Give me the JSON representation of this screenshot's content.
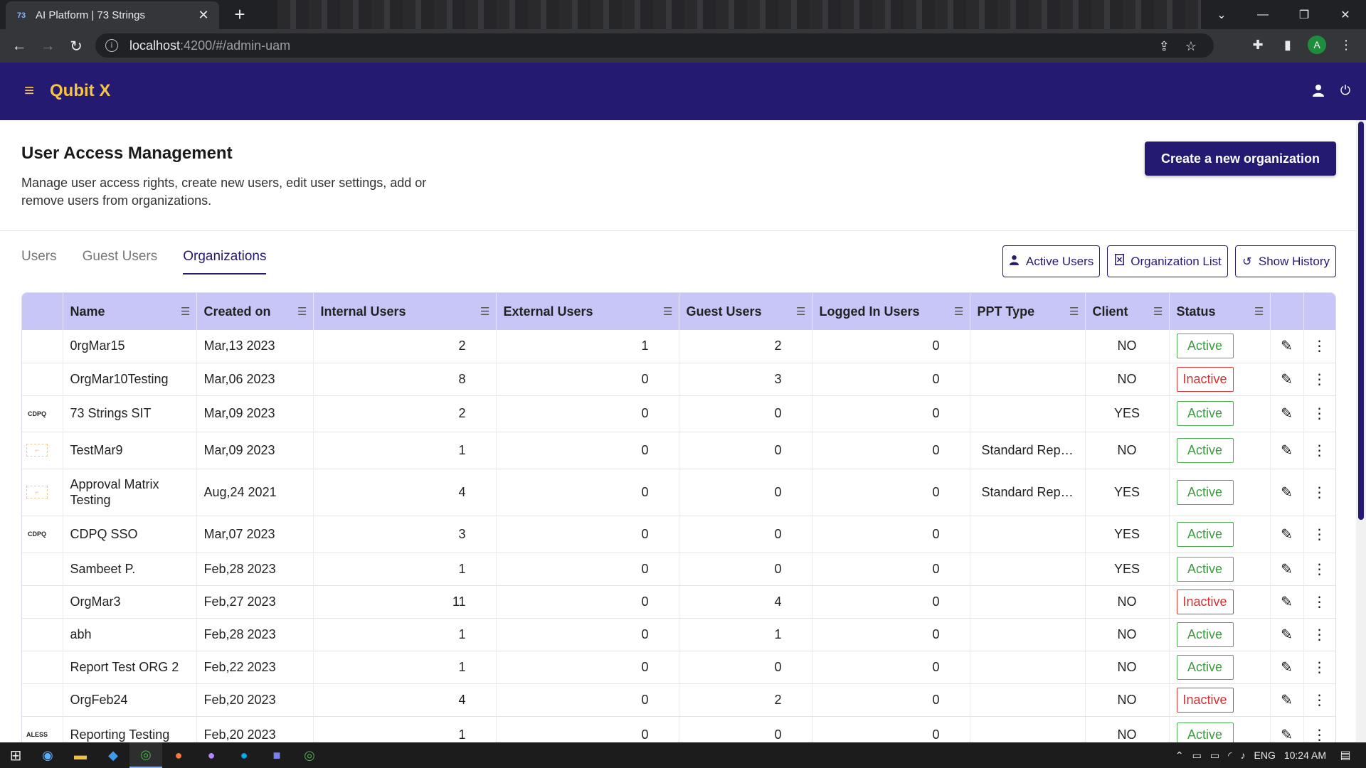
{
  "browser": {
    "tab_title": "AI Platform | 73 Strings",
    "tab_favicon": "73",
    "url_host": "localhost",
    "url_path": ":4200/#/admin-uam",
    "profile_initial": "A"
  },
  "app": {
    "brand": "Qubit X",
    "header_color": "#241a72",
    "accent_color": "#f6c445"
  },
  "page": {
    "title": "User Access Management",
    "description": "Manage user access rights, create new users, edit user settings, add or remove users from organizations.",
    "create_button": "Create a new organization"
  },
  "tabs": [
    {
      "label": "Users"
    },
    {
      "label": "Guest Users"
    },
    {
      "label": "Organizations"
    }
  ],
  "actions": {
    "active_users": "Active Users",
    "organization_list": "Organization List",
    "show_history": "Show History"
  },
  "table": {
    "columns": [
      "Name",
      "Created on",
      "Internal Users",
      "External Users",
      "Guest Users",
      "Logged In Users",
      "PPT Type",
      "Client",
      "Status"
    ],
    "rows": [
      {
        "logo": "",
        "name": "0rgMar15",
        "created": "Mar,13 2023",
        "internal": "2",
        "external": "1",
        "guest": "2",
        "logged": "0",
        "ppt": "",
        "client": "NO",
        "status": "Active",
        "status_key": "active"
      },
      {
        "logo": "",
        "name": "OrgMar10Testing",
        "created": "Mar,06 2023",
        "internal": "8",
        "external": "0",
        "guest": "3",
        "logged": "0",
        "ppt": "",
        "client": "NO",
        "status": "Inactive",
        "status_key": "inactive"
      },
      {
        "logo": "CDPQ",
        "name": "73 Strings SIT",
        "created": "Mar,09 2023",
        "internal": "2",
        "external": "0",
        "guest": "0",
        "logged": "0",
        "ppt": "",
        "client": "YES",
        "status": "Active",
        "status_key": "active"
      },
      {
        "logo": "faint",
        "name": "TestMar9",
        "created": "Mar,09 2023",
        "internal": "1",
        "external": "0",
        "guest": "0",
        "logged": "0",
        "ppt": "Standard Repo...",
        "client": "NO",
        "status": "Active",
        "status_key": "active"
      },
      {
        "logo": "faint",
        "name": "Approval Matrix Testing",
        "created": "Aug,24 2021",
        "internal": "4",
        "external": "0",
        "guest": "0",
        "logged": "0",
        "ppt": "Standard Repo...",
        "client": "YES",
        "status": "Active",
        "status_key": "active"
      },
      {
        "logo": "CDPQ",
        "name": "CDPQ SSO",
        "created": "Mar,07 2023",
        "internal": "3",
        "external": "0",
        "guest": "0",
        "logged": "0",
        "ppt": "",
        "client": "YES",
        "status": "Active",
        "status_key": "active"
      },
      {
        "logo": "",
        "name": "Sambeet P.",
        "created": "Feb,28 2023",
        "internal": "1",
        "external": "0",
        "guest": "0",
        "logged": "0",
        "ppt": "",
        "client": "YES",
        "status": "Active",
        "status_key": "active"
      },
      {
        "logo": "",
        "name": "OrgMar3",
        "created": "Feb,27 2023",
        "internal": "11",
        "external": "0",
        "guest": "4",
        "logged": "0",
        "ppt": "",
        "client": "NO",
        "status": "Inactive",
        "status_key": "inactive"
      },
      {
        "logo": "",
        "name": "abh",
        "created": "Feb,28 2023",
        "internal": "1",
        "external": "0",
        "guest": "1",
        "logged": "0",
        "ppt": "",
        "client": "NO",
        "status": "Active",
        "status_key": "active"
      },
      {
        "logo": "",
        "name": "Report Test ORG 2",
        "created": "Feb,22 2023",
        "internal": "1",
        "external": "0",
        "guest": "0",
        "logged": "0",
        "ppt": "",
        "client": "NO",
        "status": "Active",
        "status_key": "active"
      },
      {
        "logo": "",
        "name": "OrgFeb24",
        "created": "Feb,20 2023",
        "internal": "4",
        "external": "0",
        "guest": "2",
        "logged": "0",
        "ppt": "",
        "client": "NO",
        "status": "Inactive",
        "status_key": "inactive"
      },
      {
        "logo": "ALESS",
        "name": "Reporting Testing",
        "created": "Feb,20 2023",
        "internal": "1",
        "external": "0",
        "guest": "0",
        "logged": "0",
        "ppt": "",
        "client": "NO",
        "status": "Active",
        "status_key": "active"
      }
    ]
  },
  "status_colors": {
    "active": "#3c9a40",
    "inactive": "#d32f2f"
  },
  "taskbar": {
    "lang": "ENG",
    "time": "10:24 AM"
  }
}
